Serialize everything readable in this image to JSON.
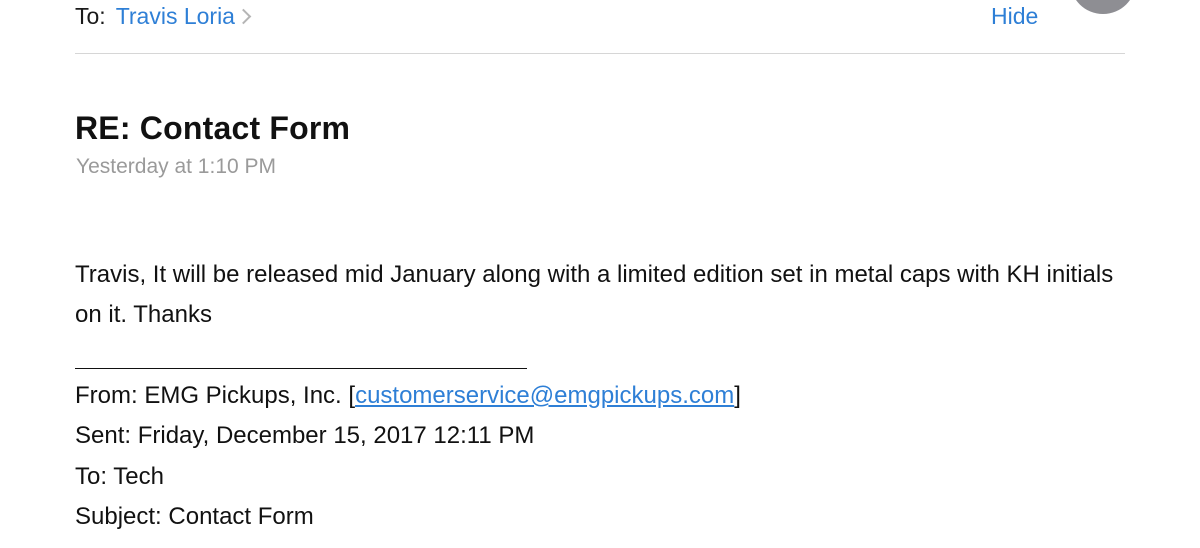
{
  "header": {
    "to_prefix": "To:",
    "to_name": "Travis Loria",
    "hide_label": "Hide"
  },
  "message": {
    "subject": "RE: Contact Form",
    "date": "Yesterday at 1:10 PM",
    "body": "Travis, It will be released mid January along with a limited edition set in metal caps with KH initials on it. Thanks"
  },
  "quoted": {
    "from_label": "From: EMG Pickups, Inc. [",
    "from_email": "customerservice@emgpickups.com",
    "from_close": "]",
    "sent": "Sent: Friday, December 15, 2017 12:11 PM",
    "to": "To: Tech",
    "subject": "Subject: Contact Form"
  },
  "colors": {
    "link": "#2e7fd6",
    "secondary_text": "#9a9a9a",
    "divider": "#d6d6d6"
  },
  "icons": {
    "recipient_chevron": "chevron-right-icon",
    "avatar": "avatar"
  }
}
